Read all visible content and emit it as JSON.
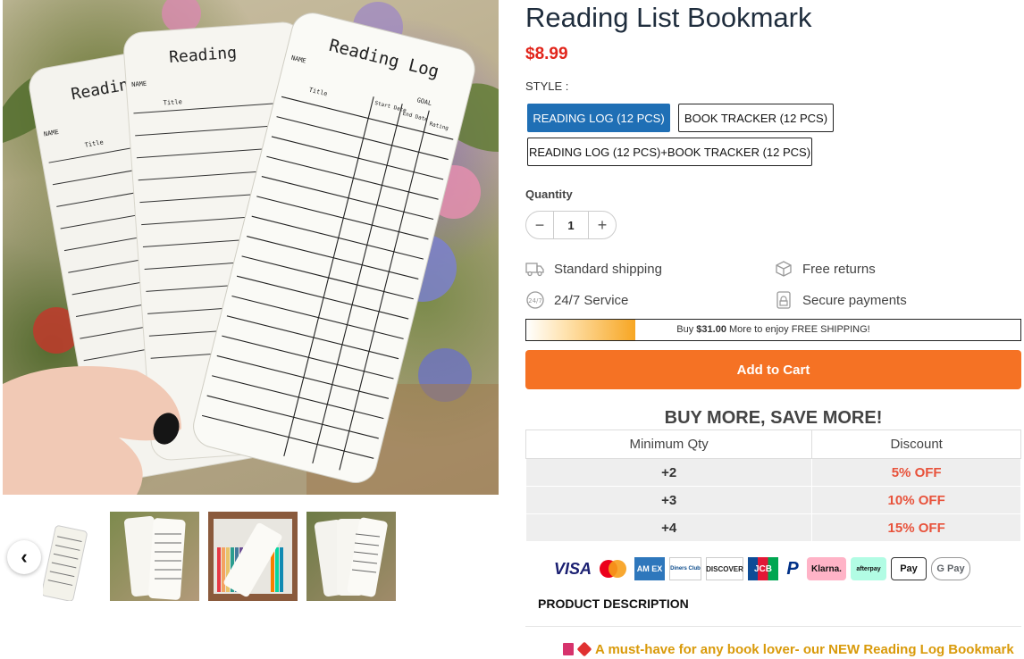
{
  "product": {
    "title": "Reading List Bookmark",
    "price": "$8.99",
    "style_label": "STYLE :",
    "styles": [
      {
        "label": "READING LOG (12 PCS)",
        "selected": true
      },
      {
        "label": "BOOK TRACKER (12 PCS)",
        "selected": false
      },
      {
        "label": "READING LOG (12 PCS)+BOOK TRACKER (12 PCS)",
        "selected": false
      }
    ],
    "quantity_label": "Quantity",
    "quantity": "1"
  },
  "gallery": {
    "card_titles": [
      "Reading",
      "Reading",
      "Reading Log"
    ],
    "card_fields": [
      "NAME",
      "Title",
      "Start Date",
      "End Date",
      "Rating",
      "GOAL"
    ],
    "thumbnails": [
      "thumb-1",
      "thumb-2",
      "thumb-3",
      "thumb-4"
    ]
  },
  "features": [
    {
      "icon": "truck-icon",
      "label": "Standard shipping"
    },
    {
      "icon": "box-return-icon",
      "label": "Free returns"
    },
    {
      "icon": "service-24-7-icon",
      "label": "24/7 Service"
    },
    {
      "icon": "secure-payment-icon",
      "label": "Secure payments"
    }
  ],
  "shipping_bar": {
    "prefix": "Buy",
    "amount": "$31.00",
    "suffix": "More to enjoy FREE SHIPPING!",
    "progress_fraction": 0.22
  },
  "add_to_cart_label": "Add to Cart",
  "discount": {
    "heading": "BUY MORE, SAVE MORE!",
    "columns": [
      "Minimum Qty",
      "Discount"
    ],
    "rows": [
      {
        "qty": "+2",
        "off": "5% OFF"
      },
      {
        "qty": "+3",
        "off": "10% OFF"
      },
      {
        "qty": "+4",
        "off": "15% OFF"
      }
    ]
  },
  "payments": [
    "VISA",
    "Mastercard",
    "AMEX",
    "Diners Club",
    "DISCOVER",
    "JCB",
    "PayPal",
    "Klarna.",
    "afterpay",
    "Apple Pay",
    "G Pay"
  ],
  "payment_texts": {
    "visa": "VISA",
    "amex": "AM EX",
    "diners": "Diners Club",
    "discover": "DISCOVER",
    "jcb": "JCB",
    "paypal": "P",
    "klarna": "Klarna.",
    "afterpay": "afterpay",
    "applepay": " Pay",
    "gpay": "G Pay"
  },
  "description": {
    "heading": "PRODUCT DESCRIPTION",
    "promo": "A must-have for any book lover- our NEW Reading Log Bookmark"
  },
  "colors": {
    "accent_blue": "#1f6fb5",
    "price_red": "#e1251b",
    "cart_orange": "#f57224",
    "discount_red": "#e8523b",
    "promo_gold": "#d99a0a"
  }
}
